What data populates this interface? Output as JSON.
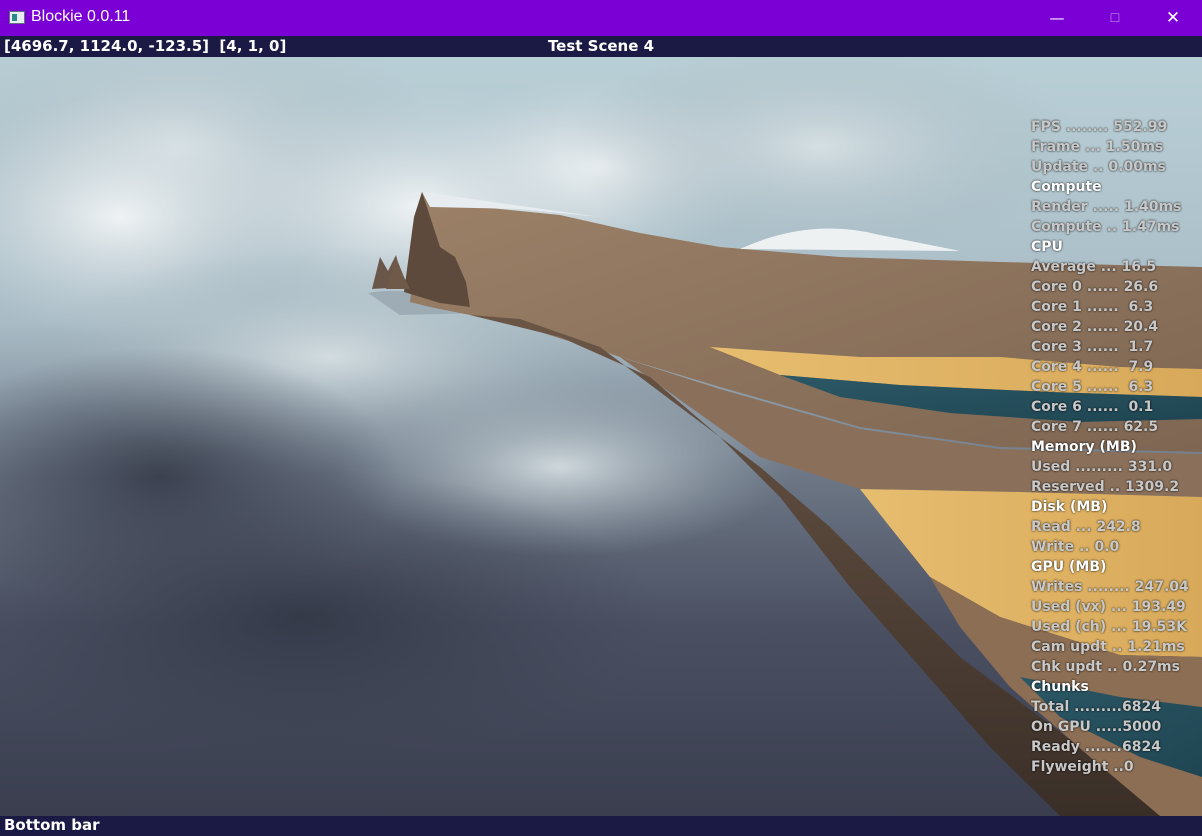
{
  "window": {
    "title": "Blockie 0.0.11",
    "min_glyph": "—",
    "max_glyph": "☐",
    "close_glyph": "✕"
  },
  "topbar": {
    "coords": "[4696.7, 1124.0, -123.5]  [4, 1, 0]",
    "scene_name": "Test Scene 4"
  },
  "stats": [
    {
      "text": "FPS ........ 552.99",
      "head": false
    },
    {
      "text": "Frame ... 1.50ms",
      "head": false
    },
    {
      "text": "Update .. 0.00ms",
      "head": false
    },
    {
      "text": "Compute",
      "head": true
    },
    {
      "text": "Render ..... 1.40ms",
      "head": false
    },
    {
      "text": "Compute .. 1.47ms",
      "head": false
    },
    {
      "text": "CPU",
      "head": true
    },
    {
      "text": "Average ... 16.5",
      "head": false
    },
    {
      "text": "Core 0 ...... 26.6",
      "head": false
    },
    {
      "text": "Core 1 ......  6.3",
      "head": false
    },
    {
      "text": "Core 2 ...... 20.4",
      "head": false
    },
    {
      "text": "Core 3 ......  1.7",
      "head": false
    },
    {
      "text": "Core 4 ......  7.9",
      "head": false
    },
    {
      "text": "Core 5 ......  6.3",
      "head": false
    },
    {
      "text": "Core 6 ......  0.1",
      "head": false
    },
    {
      "text": "Core 7 ...... 62.5",
      "head": false
    },
    {
      "text": "Memory (MB)",
      "head": true
    },
    {
      "text": "Used ......... 331.0",
      "head": false
    },
    {
      "text": "Reserved .. 1309.2",
      "head": false
    },
    {
      "text": "Disk (MB)",
      "head": true
    },
    {
      "text": "Read ... 242.8",
      "head": false
    },
    {
      "text": "Write .. 0.0",
      "head": false
    },
    {
      "text": "GPU (MB)",
      "head": true
    },
    {
      "text": "Writes ........ 247.04",
      "head": false
    },
    {
      "text": "Used (vx) ... 193.49",
      "head": false
    },
    {
      "text": "Used (ch) ... 19.53K",
      "head": false
    },
    {
      "text": "Cam updt .. 1.21ms",
      "head": false
    },
    {
      "text": "Chk updt .. 0.27ms",
      "head": false
    },
    {
      "text": "Chunks",
      "head": true
    },
    {
      "text": "Total .........6824",
      "head": false
    },
    {
      "text": "On GPU .....5000",
      "head": false
    },
    {
      "text": "Ready .......6824",
      "head": false
    },
    {
      "text": "Flyweight ..0",
      "head": false
    }
  ],
  "bottombar": {
    "label": "Bottom bar"
  },
  "colors": {
    "title_bar": "#7a00d6",
    "info_bar": "#1a1a44"
  }
}
